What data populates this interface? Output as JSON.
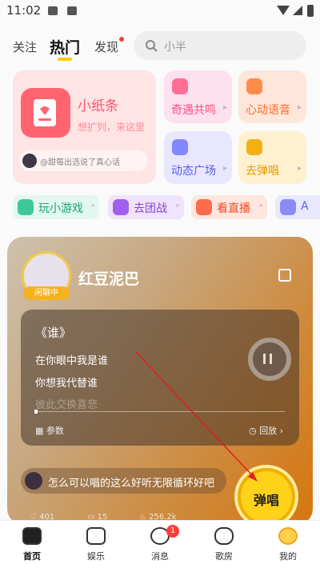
{
  "status_bar": {
    "time": "11:02"
  },
  "top_nav": {
    "tabs": [
      {
        "label": "关注"
      },
      {
        "label": "热门",
        "active": true
      },
      {
        "label": "发现",
        "has_dot": true
      }
    ],
    "search": {
      "placeholder": "小半"
    }
  },
  "feature_cards": {
    "big": {
      "title": "小纸条",
      "subtitle": "想扩列，来这里",
      "hint": "@甜莓出选说了真心话"
    },
    "tiles": [
      {
        "label": "奇遇共鸣",
        "color": "#ff6d93"
      },
      {
        "label": "心动语音",
        "color": "#ff8b4a"
      },
      {
        "label": "动态广场",
        "color": "#8486ff"
      },
      {
        "label": "去弹唱",
        "color": "#f3b013"
      }
    ]
  },
  "shortcuts": [
    {
      "label": "玩小游戏",
      "color": "#3fc79a"
    },
    {
      "label": "去团战",
      "color": "#a060ee"
    },
    {
      "label": "看直播",
      "color": "#ff6b4a"
    },
    {
      "label": "A",
      "color": "#8a8cf5"
    }
  ],
  "song_card": {
    "user_name": "红豆泥巴",
    "live_tag": "闲聊中",
    "song_title": "《谁》",
    "lyrics": [
      "在你眼中我是谁",
      "你想我代替谁",
      "彼此交换喜悲"
    ],
    "footer_left": "参数",
    "footer_right": "回放",
    "comment": "怎么可以唱的这么好听无限循环好吧",
    "stats": [
      "401",
      "15",
      "256.2k"
    ],
    "action_button": "弹唱"
  },
  "bottom_nav": {
    "items": [
      {
        "label": "首页",
        "active": true
      },
      {
        "label": "娱乐"
      },
      {
        "label": "消息",
        "badge": "1"
      },
      {
        "label": "歌房"
      },
      {
        "label": "我的"
      }
    ]
  },
  "colors": {
    "accent": "#ffcc00",
    "brand_red": "#ff5567",
    "action": "#ffd21a"
  }
}
